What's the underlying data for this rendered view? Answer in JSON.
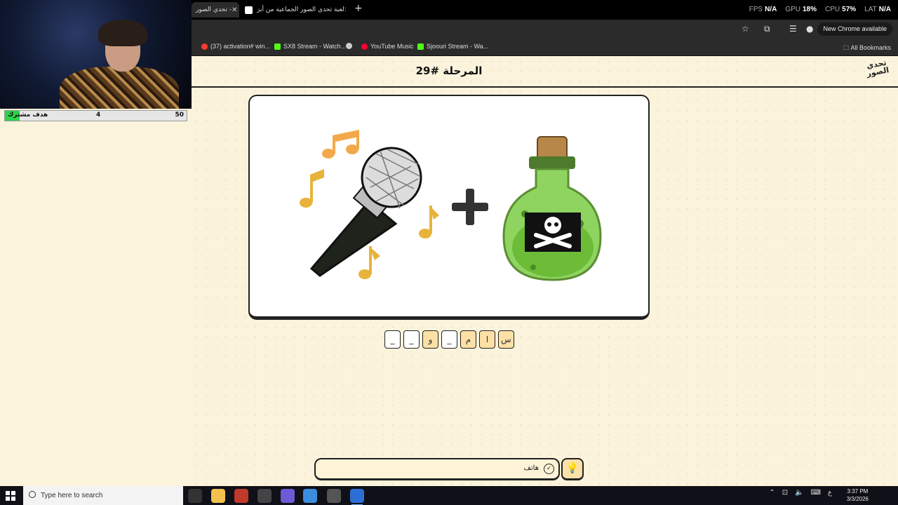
{
  "browser": {
    "tabs": [
      {
        "title": "تحدي الصور -",
        "active": true
      },
      {
        "title": "لعبة تحدي الصور الجماعية من أبز",
        "active": false
      }
    ],
    "new_tab_label": "+",
    "perf": {
      "fps_label": "FPS",
      "fps_value": "N/A",
      "gpu_label": "GPU",
      "gpu_value": "18%",
      "cpu_label": "CPU",
      "cpu_value": "57%",
      "lat_label": "LAT",
      "lat_value": "N/A"
    },
    "new_chrome_label": "New Chrome available",
    "bookmarks": [
      {
        "label": "(37) activation# win...",
        "color": "#ff3b30"
      },
      {
        "label": "SX8 Stream - Watch...",
        "color": "#53fc18"
      },
      {
        "label": "YouTube Music",
        "color": "#ff0033"
      },
      {
        "label": "Sjoouri Stream - Wa...",
        "color": "#53fc18"
      }
    ],
    "all_bookmarks_label": "All Bookmarks"
  },
  "webcam": {
    "goal_label": "هدف مشترك",
    "goal_current": "4",
    "goal_target": "50",
    "goal_progress": 0.08
  },
  "game": {
    "logo_text": "تحدي الصور",
    "level_title": "المرحلة #29",
    "puzzle_parts": [
      "microphone-with-music-notes",
      "plus",
      "poison-bottle"
    ],
    "answer_slots": [
      "س",
      "ا",
      "م",
      "_",
      "و",
      "_",
      "_"
    ],
    "answer_filled": [
      true,
      true,
      true,
      false,
      true,
      false,
      false
    ],
    "hint_text": "هاتف",
    "accent_color": "#fde0a6",
    "bg_color": "#fbf3dc"
  },
  "taskbar": {
    "search_placeholder": "Type here to search",
    "time": "3:37 PM",
    "date": "3/3/2026",
    "lang": "ع"
  }
}
